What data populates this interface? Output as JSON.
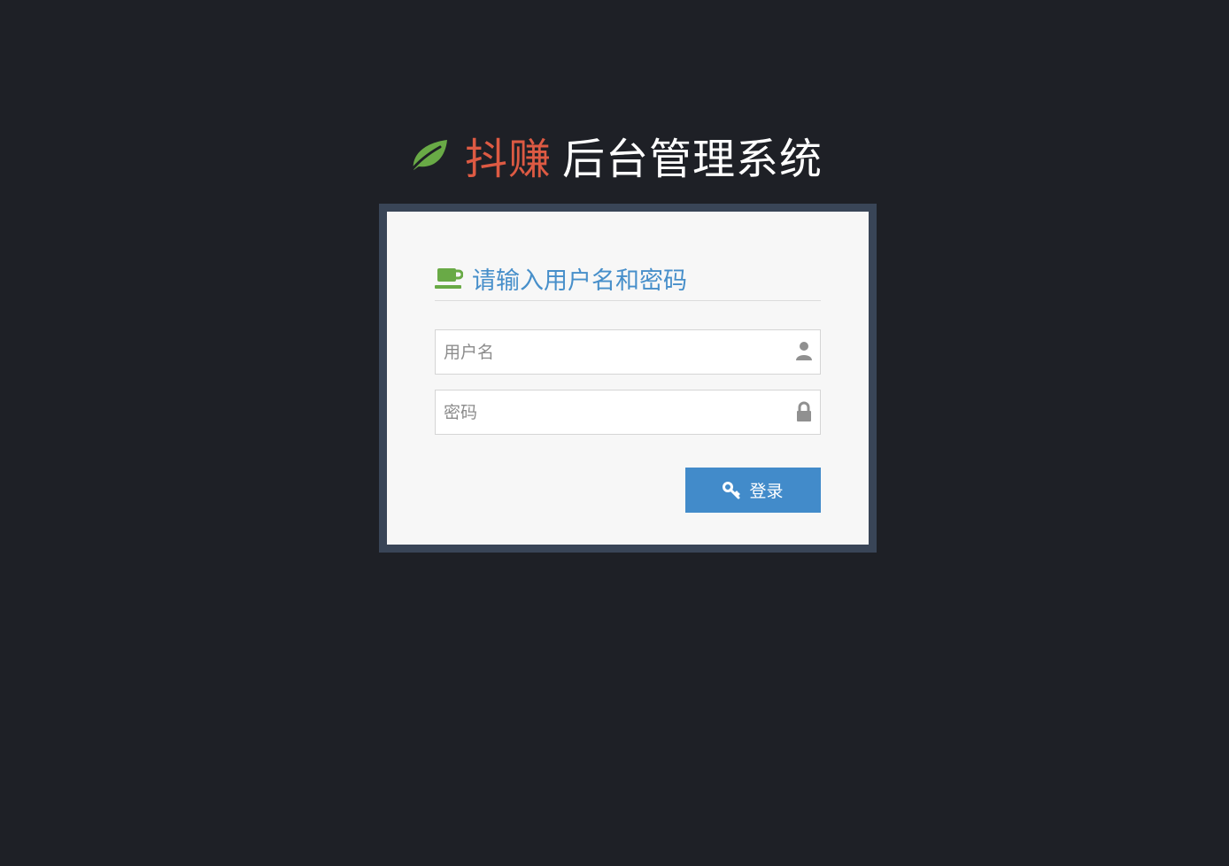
{
  "brand": {
    "icon": "leaf-icon",
    "name": "抖赚",
    "suffix": "后台管理系统",
    "name_color": "#dd5a43",
    "icon_color": "#69aa46"
  },
  "login_box": {
    "icon": "coffee-icon",
    "heading": "请输入用户名和密码",
    "heading_color": "#478fca",
    "username": {
      "placeholder": "用户名",
      "value": "",
      "icon": "user-icon"
    },
    "password": {
      "placeholder": "密码",
      "value": "",
      "icon": "lock-icon"
    },
    "login_button": {
      "label": "登录",
      "icon": "key-icon",
      "color": "#428bca"
    }
  }
}
